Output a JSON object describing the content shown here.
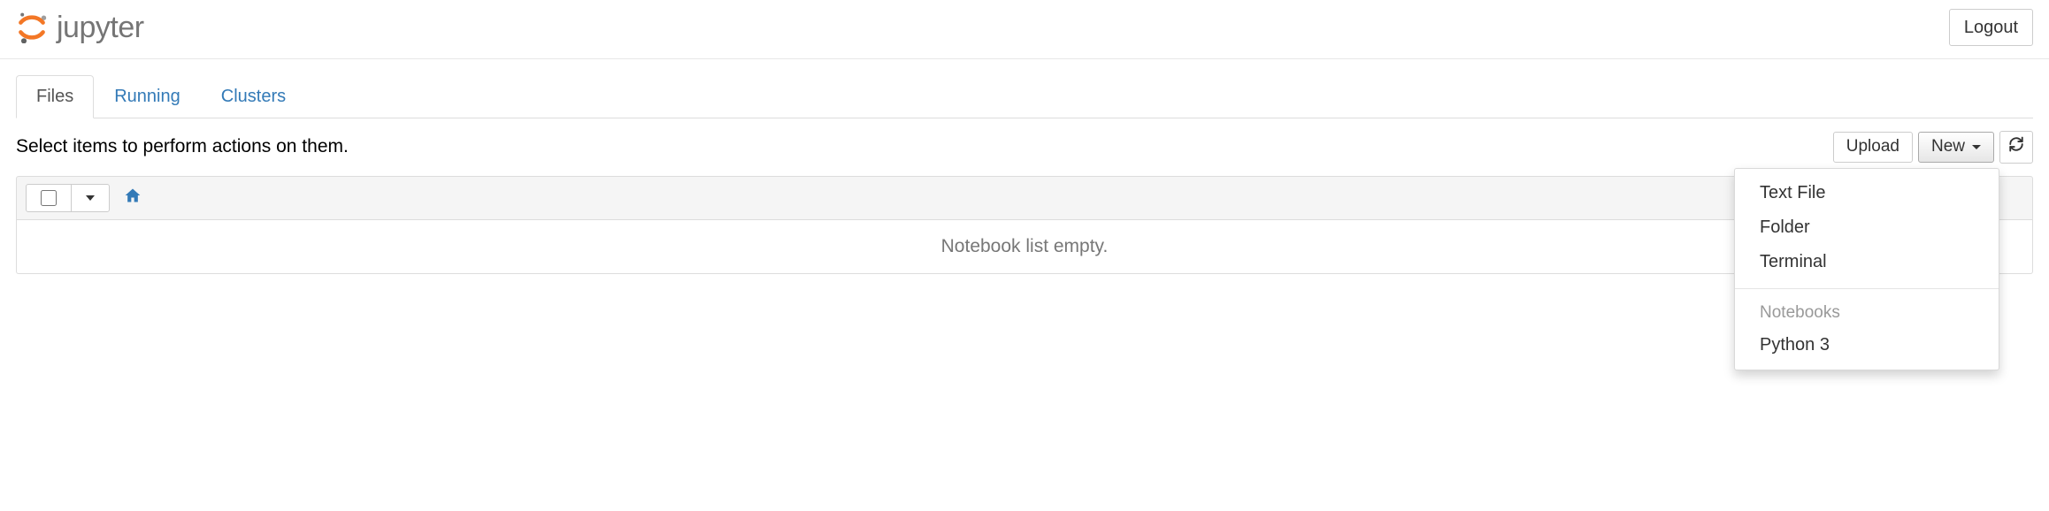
{
  "header": {
    "brand": "jupyter",
    "logout_label": "Logout"
  },
  "tabs": [
    {
      "label": "Files",
      "active": true
    },
    {
      "label": "Running",
      "active": false
    },
    {
      "label": "Clusters",
      "active": false
    }
  ],
  "toolbar": {
    "hint_text": "Select items to perform actions on them.",
    "upload_label": "Upload",
    "new_label": "New"
  },
  "list": {
    "empty_text": "Notebook list empty."
  },
  "new_menu": {
    "items": [
      {
        "label": "Text File"
      },
      {
        "label": "Folder"
      },
      {
        "label": "Terminal"
      }
    ],
    "section_header": "Notebooks",
    "notebook_items": [
      {
        "label": "Python 3"
      }
    ]
  }
}
